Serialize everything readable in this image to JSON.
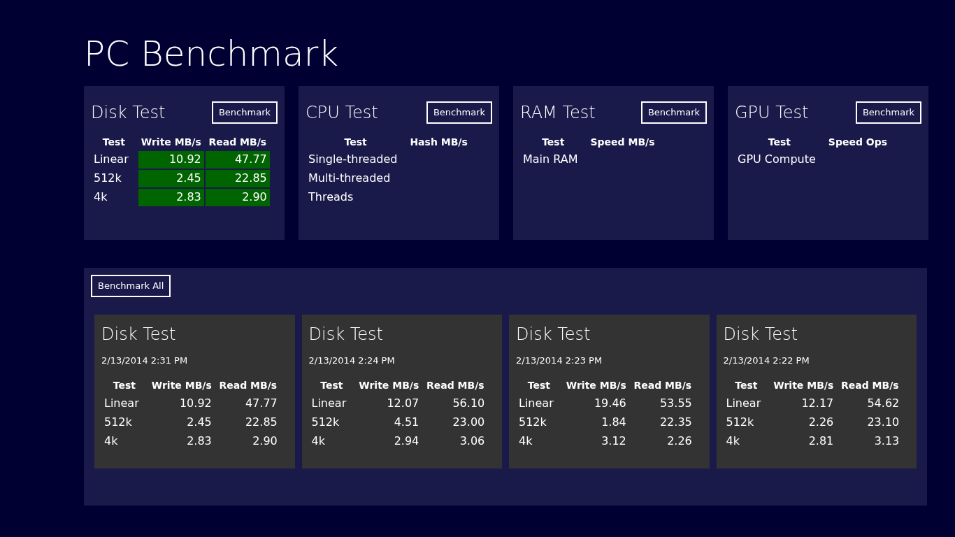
{
  "title": "PC Benchmark",
  "tests": [
    {
      "title": "Disk Test",
      "button": "Benchmark",
      "columns": [
        "Test",
        "Write MB/s",
        "Read MB/s"
      ],
      "rows": [
        {
          "label": "Linear",
          "values": [
            "10.92",
            "47.77"
          ]
        },
        {
          "label": "512k",
          "values": [
            "2.45",
            "22.85"
          ]
        },
        {
          "label": "4k",
          "values": [
            "2.83",
            "2.90"
          ]
        }
      ]
    },
    {
      "title": "CPU Test",
      "button": "Benchmark",
      "columns": [
        "Test",
        "Hash MB/s"
      ],
      "rows": [
        {
          "label": "Single-threaded",
          "values": []
        },
        {
          "label": "Multi-threaded",
          "values": []
        },
        {
          "label": "Threads",
          "values": []
        }
      ]
    },
    {
      "title": "RAM Test",
      "button": "Benchmark",
      "columns": [
        "Test",
        "Speed MB/s"
      ],
      "rows": [
        {
          "label": "Main RAM",
          "values": []
        }
      ]
    },
    {
      "title": "GPU Test",
      "button": "Benchmark",
      "columns": [
        "Test",
        "Speed Ops"
      ],
      "rows": [
        {
          "label": "GPU Compute",
          "values": []
        }
      ]
    }
  ],
  "benchmark_all": "Benchmark All",
  "history": [
    {
      "title": "Disk Test",
      "date": "2/13/2014 2:31 PM",
      "columns": [
        "Test",
        "Write MB/s",
        "Read MB/s"
      ],
      "rows": [
        {
          "label": "Linear",
          "values": [
            "10.92",
            "47.77"
          ]
        },
        {
          "label": "512k",
          "values": [
            "2.45",
            "22.85"
          ]
        },
        {
          "label": "4k",
          "values": [
            "2.83",
            "2.90"
          ]
        }
      ]
    },
    {
      "title": "Disk Test",
      "date": "2/13/2014 2:24 PM",
      "columns": [
        "Test",
        "Write MB/s",
        "Read MB/s"
      ],
      "rows": [
        {
          "label": "Linear",
          "values": [
            "12.07",
            "56.10"
          ]
        },
        {
          "label": "512k",
          "values": [
            "4.51",
            "23.00"
          ]
        },
        {
          "label": "4k",
          "values": [
            "2.94",
            "3.06"
          ]
        }
      ]
    },
    {
      "title": "Disk Test",
      "date": "2/13/2014 2:23 PM",
      "columns": [
        "Test",
        "Write MB/s",
        "Read MB/s"
      ],
      "rows": [
        {
          "label": "Linear",
          "values": [
            "19.46",
            "53.55"
          ]
        },
        {
          "label": "512k",
          "values": [
            "1.84",
            "22.35"
          ]
        },
        {
          "label": "4k",
          "values": [
            "3.12",
            "2.26"
          ]
        }
      ]
    },
    {
      "title": "Disk Test",
      "date": "2/13/2014 2:22 PM",
      "columns": [
        "Test",
        "Write MB/s",
        "Read MB/s"
      ],
      "rows": [
        {
          "label": "Linear",
          "values": [
            "12.17",
            "54.62"
          ]
        },
        {
          "label": "512k",
          "values": [
            "2.26",
            "23.10"
          ]
        },
        {
          "label": "4k",
          "values": [
            "2.81",
            "3.13"
          ]
        }
      ]
    }
  ]
}
